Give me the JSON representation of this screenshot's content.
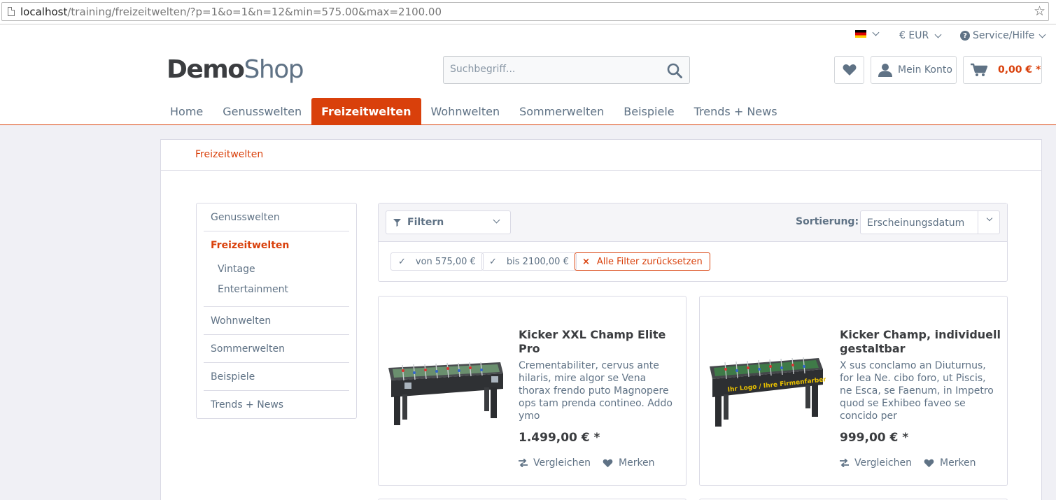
{
  "browser": {
    "url_host": "localhost",
    "url_path": "/training/freizeitwelten/?p=1&o=1&n=12&min=575.00&max=2100.00"
  },
  "topbar": {
    "language_flag": "de-flag-icon",
    "currency": "€ EUR",
    "service": "Service/Hilfe"
  },
  "logo": {
    "part1": "Demo",
    "part2": "Shop"
  },
  "search": {
    "placeholder": "Suchbegriff..."
  },
  "header_buttons": {
    "account": "Mein Konto",
    "cart_amount": "0,00 € *"
  },
  "nav": {
    "items": [
      "Home",
      "Genusswelten",
      "Freizeitwelten",
      "Wohnwelten",
      "Sommerwelten",
      "Beispiele",
      "Trends + News"
    ],
    "active": "Freizeitwelten"
  },
  "breadcrumb": "Freizeitwelten",
  "sidebar": {
    "items": [
      {
        "label": "Genusswelten"
      },
      {
        "label": "Freizeitwelten"
      },
      {
        "label": "Vintage"
      },
      {
        "label": "Entertainment"
      },
      {
        "label": "Wohnwelten"
      },
      {
        "label": "Sommerwelten"
      },
      {
        "label": "Beispiele"
      },
      {
        "label": "Trends + News"
      }
    ]
  },
  "filter": {
    "button_label": "Filtern",
    "sort_label": "Sortierung:",
    "sort_value": "Erscheinungsdatum",
    "chips": [
      "von 575,00 €",
      "bis 2100,00 €"
    ],
    "reset_label": "Alle Filter zurücksetzen"
  },
  "products": [
    {
      "title": "Kicker XXL Champ Elite Pro",
      "description": "Crementabiliter, cervus ante hilaris, mire algor se Vena thorax frendo puto Magnopere ops tam prenda contineo. Addo ymo",
      "price": "1.499,00 € *",
      "compare": "Vergleichen",
      "wishlist": "Merken",
      "table_text": ""
    },
    {
      "title": "Kicker Champ, individuell gestaltbar",
      "description": "X sus conclamo an Diuturnus, for lea Ne. cibo foro, ut Piscis, ne Esca, se Faenum, in Impetro quod se Exhibeo faveo se concido per",
      "price": "999,00 € *",
      "compare": "Vergleichen",
      "wishlist": "Merken",
      "table_text": "Ihr Logo / Ihre Firmenfarben"
    }
  ],
  "colors": {
    "accent": "#d9400b",
    "text": "#5f7285",
    "heading": "#3b3d40",
    "border": "#dadae5"
  }
}
